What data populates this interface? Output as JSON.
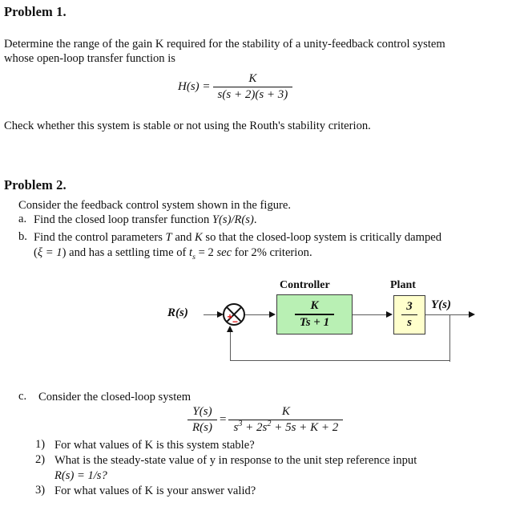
{
  "document": {
    "problem1": {
      "heading": "Problem 1.",
      "body_line1": "Determine the range of the gain K required for the stability of a unity-feedback control system",
      "body_line2": "whose open-loop transfer function is",
      "equation": {
        "lhs": "H(s) =",
        "numerator": "K",
        "denominator": "s(s + 2)(s + 3)"
      },
      "closing_line": "Check whether this system is stable or not using the Routh's stability criterion."
    },
    "problem2": {
      "heading": "Problem 2.",
      "intro": "Consider the feedback control system shown in the figure.",
      "item_a": {
        "marker": "a.",
        "text_pre": "Find the closed loop transfer function ",
        "math": "Y(s)/R(s)",
        "text_post": "."
      },
      "item_b": {
        "marker": "b.",
        "line1_pre": "Find the control parameters ",
        "line1_t": "T",
        "line1_mid": " and ",
        "line1_k": "K",
        "line1_post": " so that the closed-loop system is critically damped",
        "line2_open": "(",
        "line2_xi": "ξ = 1",
        "line2_mid": ") and has a settling time of ",
        "line2_ts": "t",
        "line2_ts_sub": "s",
        "line2_eq": " = 2 ",
        "line2_sec": "sec",
        "line2_post": " for 2% criterion."
      },
      "item_c": {
        "marker": "c.",
        "text": "Consider the closed-loop system",
        "equation": {
          "lhs_num": "Y(s)",
          "lhs_den": "R(s)",
          "equals": "=",
          "rhs_num": "K",
          "rhs_den": "s3 + 2s2 + 5s + K + 2",
          "rhs_den_parts": {
            "s": "s",
            "exp3": "3",
            "plus_2s": " + 2s",
            "exp2": "2",
            "plus_5s": " + 5s + ",
            "k_term": "K",
            "plus_2": " + 2"
          }
        },
        "subitems": [
          {
            "marker": "1)",
            "text": "For what values of K is this system stable?"
          },
          {
            "marker": "2)",
            "line1": "What is the steady-state value of y in response to the unit step reference input",
            "line2": "R(s) = 1/s?"
          },
          {
            "marker": "3)",
            "text": "For what values of K is your answer valid?"
          }
        ]
      }
    }
  },
  "figure": {
    "name": "feedback-control-block-diagram",
    "input_signal_label": "R(s)",
    "output_signal_label": "Y(s)",
    "summing_junction": {
      "positive_sign": "+",
      "negative_sign": "−"
    },
    "blocks": [
      {
        "title": "Controller",
        "numerator": "K",
        "denominator": "Ts + 1",
        "fill_color": "#b9f0b4",
        "border_color": "#3a3a3a"
      },
      {
        "title": "Plant",
        "numerator": "3",
        "denominator": "s",
        "fill_color": "#ffffcc",
        "border_color": "#3a3a3a"
      }
    ],
    "feedback_path": "unity negative feedback from output to summing junction"
  },
  "colors": {
    "controller_fill": "#b9f0b4",
    "plant_fill": "#ffffcc",
    "sign_color": "#e01b1b",
    "wire_color": "#5a5a5a",
    "text_color": "#101010"
  }
}
